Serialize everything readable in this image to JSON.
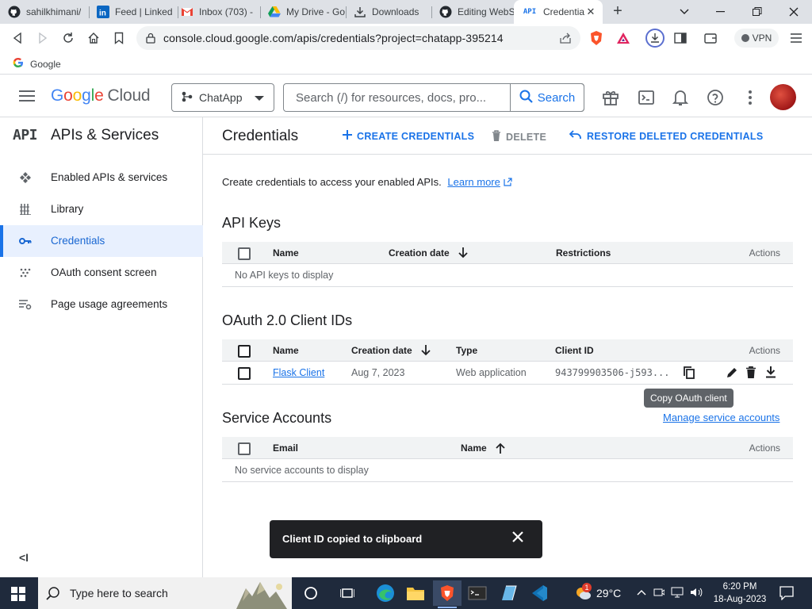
{
  "browser": {
    "tabs": [
      {
        "label": "sahilkhimani/",
        "icon": "github-icon"
      },
      {
        "label": "Feed | Linked",
        "icon": "linkedin-icon"
      },
      {
        "label": "Inbox (703) -",
        "icon": "gmail-icon"
      },
      {
        "label": "My Drive - Go",
        "icon": "drive-icon"
      },
      {
        "label": "Downloads",
        "icon": "download-icon"
      },
      {
        "label": "Editing WebS",
        "icon": "github-icon"
      },
      {
        "label": "Credentia",
        "icon": "api-icon",
        "active": true
      }
    ],
    "url": "console.cloud.google.com/apis/credentials?project=chatapp-395214",
    "extension_badge": "3",
    "vpn_label": "VPN",
    "bookmark": "Google"
  },
  "header": {
    "logo_google": [
      "G",
      "o",
      "o",
      "g",
      "l",
      "e"
    ],
    "logo_cloud": "Cloud",
    "project": "ChatApp",
    "search_placeholder": "Search (/) for resources, docs, pro...",
    "search_button": "Search"
  },
  "sidebar": {
    "api_glyph": "API",
    "title": "APIs & Services",
    "items": [
      {
        "label": "Enabled APIs & services",
        "icon": "enabled-apis-icon"
      },
      {
        "label": "Library",
        "icon": "library-icon"
      },
      {
        "label": "Credentials",
        "icon": "key-icon",
        "active": true
      },
      {
        "label": "OAuth consent screen",
        "icon": "oauth-consent-icon"
      },
      {
        "label": "Page usage agreements",
        "icon": "page-usage-icon"
      }
    ],
    "collapse": "<I"
  },
  "main": {
    "title": "Credentials",
    "actions": {
      "create": "CREATE CREDENTIALS",
      "delete": "DELETE",
      "restore": "RESTORE DELETED CREDENTIALS"
    },
    "intro_text": "Create credentials to access your enabled APIs.",
    "learn_more": "Learn more",
    "api_keys": {
      "title": "API Keys",
      "columns": {
        "name": "Name",
        "date": "Creation date",
        "restrictions": "Restrictions",
        "actions": "Actions"
      },
      "empty": "No API keys to display"
    },
    "oauth": {
      "title": "OAuth 2.0 Client IDs",
      "columns": {
        "name": "Name",
        "date": "Creation date",
        "type": "Type",
        "client_id": "Client ID",
        "actions": "Actions"
      },
      "rows": [
        {
          "name": "Flask Client",
          "date": "Aug 7, 2023",
          "type": "Web application",
          "client_id": "943799903506-j593..."
        }
      ]
    },
    "tooltip": "Copy OAuth client",
    "service_accounts": {
      "title": "Service Accounts",
      "manage_link": "Manage service accounts",
      "columns": {
        "email": "Email",
        "name": "Name",
        "actions": "Actions"
      },
      "empty": "No service accounts to display"
    },
    "snackbar": "Client ID copied to clipboard"
  },
  "taskbar": {
    "search_placeholder": "Type here to search",
    "weather": "29°C",
    "weather_badge": "1",
    "time": "6:20 PM",
    "date": "18-Aug-2023"
  },
  "colors": {
    "accent": "#1a73e8",
    "active_bg": "#e8f0fe",
    "snackbar_bg": "#202124",
    "taskbar_bg": "#1f2a3c"
  }
}
